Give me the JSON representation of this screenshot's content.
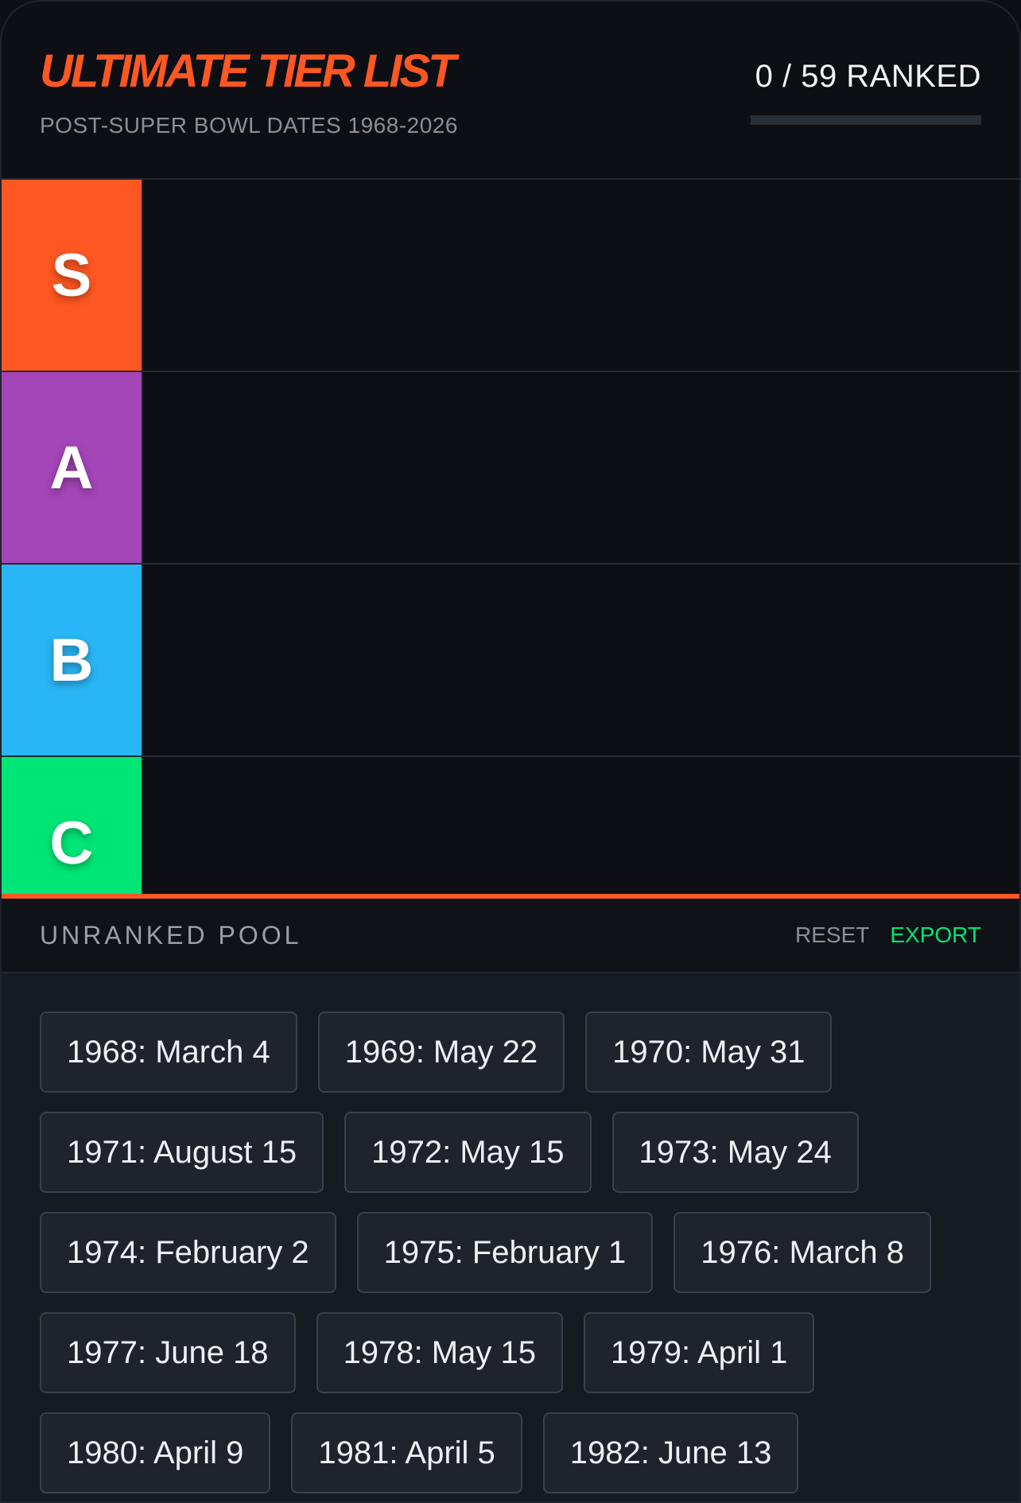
{
  "header": {
    "title": "ULTIMATE TIER LIST",
    "subtitle": "POST-SUPER BOWL DATES 1968-2026",
    "counter": "0 / 59 RANKED",
    "progress_fraction": 0
  },
  "tiers": [
    {
      "label": "S",
      "color": "#ff5722"
    },
    {
      "label": "A",
      "color": "#a445b8"
    },
    {
      "label": "B",
      "color": "#29b6f6"
    },
    {
      "label": "C",
      "color": "#00e676"
    }
  ],
  "pool": {
    "title": "UNRANKED POOL",
    "reset_label": "RESET",
    "export_label": "EXPORT",
    "items": [
      "1968: March 4",
      "1969: May 22",
      "1970: May 31",
      "1971: August 15",
      "1972: May 15",
      "1973: May 24",
      "1974: February 2",
      "1975: February 1",
      "1976: March 8",
      "1977: June 18",
      "1978: May 15",
      "1979: April 1",
      "1980: April 9",
      "1981: April 5",
      "1982: June 13"
    ]
  },
  "colors": {
    "accent": "#ff5722",
    "export": "#00e676",
    "background": "#0d0f14"
  }
}
